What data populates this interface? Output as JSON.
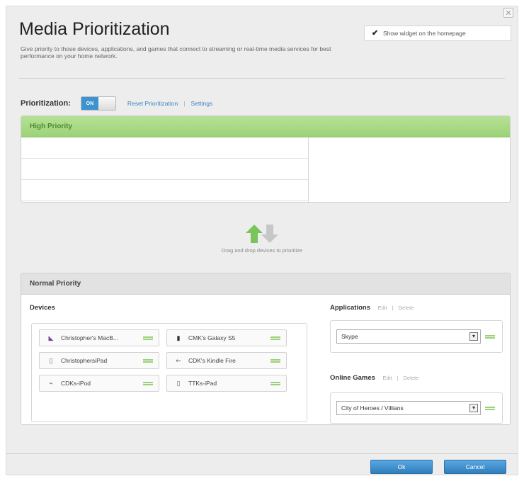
{
  "title": "Media Prioritization",
  "subtitle": "Give priority to those devices, applications, and games that connect to streaming or real-time media services for best performance on your home network.",
  "widget": {
    "label": "Show widget on the homepage",
    "checked": true
  },
  "prioritization": {
    "label": "Prioritization:",
    "toggle_label": "ON",
    "reset_link": "Reset Prioritization",
    "separator": "|",
    "settings_link": "Settings"
  },
  "high_priority": {
    "title": "High Priority"
  },
  "drag_hint": "Drag and drop devices to prioritize",
  "normal_priority": {
    "title": "Normal Priority",
    "devices_label": "Devices",
    "devices": [
      {
        "label": "Christopher's MacB...",
        "icon": "laptop-icon"
      },
      {
        "label": "CMK's Galaxy S5",
        "icon": "phone-icon"
      },
      {
        "label": "ChristophersiPad",
        "icon": "tablet-icon"
      },
      {
        "label": "CDK's Kindle Fire",
        "icon": "kindle-icon"
      },
      {
        "label": "CDKs-iPod",
        "icon": "ipod-icon"
      },
      {
        "label": "TTKs-iPad",
        "icon": "tablet-icon"
      }
    ],
    "applications": {
      "label": "Applications",
      "edit": "Edit",
      "separator": "|",
      "delete": "Delete",
      "selected": "Skype"
    },
    "online_games": {
      "label": "Online Games",
      "edit": "Edit",
      "separator": "|",
      "delete": "Delete",
      "selected": "City of Heroes / Villians"
    }
  },
  "buttons": {
    "ok": "Ok",
    "cancel": "Cancel"
  },
  "colors": {
    "accent": "#3d92d0",
    "high_priority_green": "#9dd278",
    "handle_green": "#9bd178"
  }
}
